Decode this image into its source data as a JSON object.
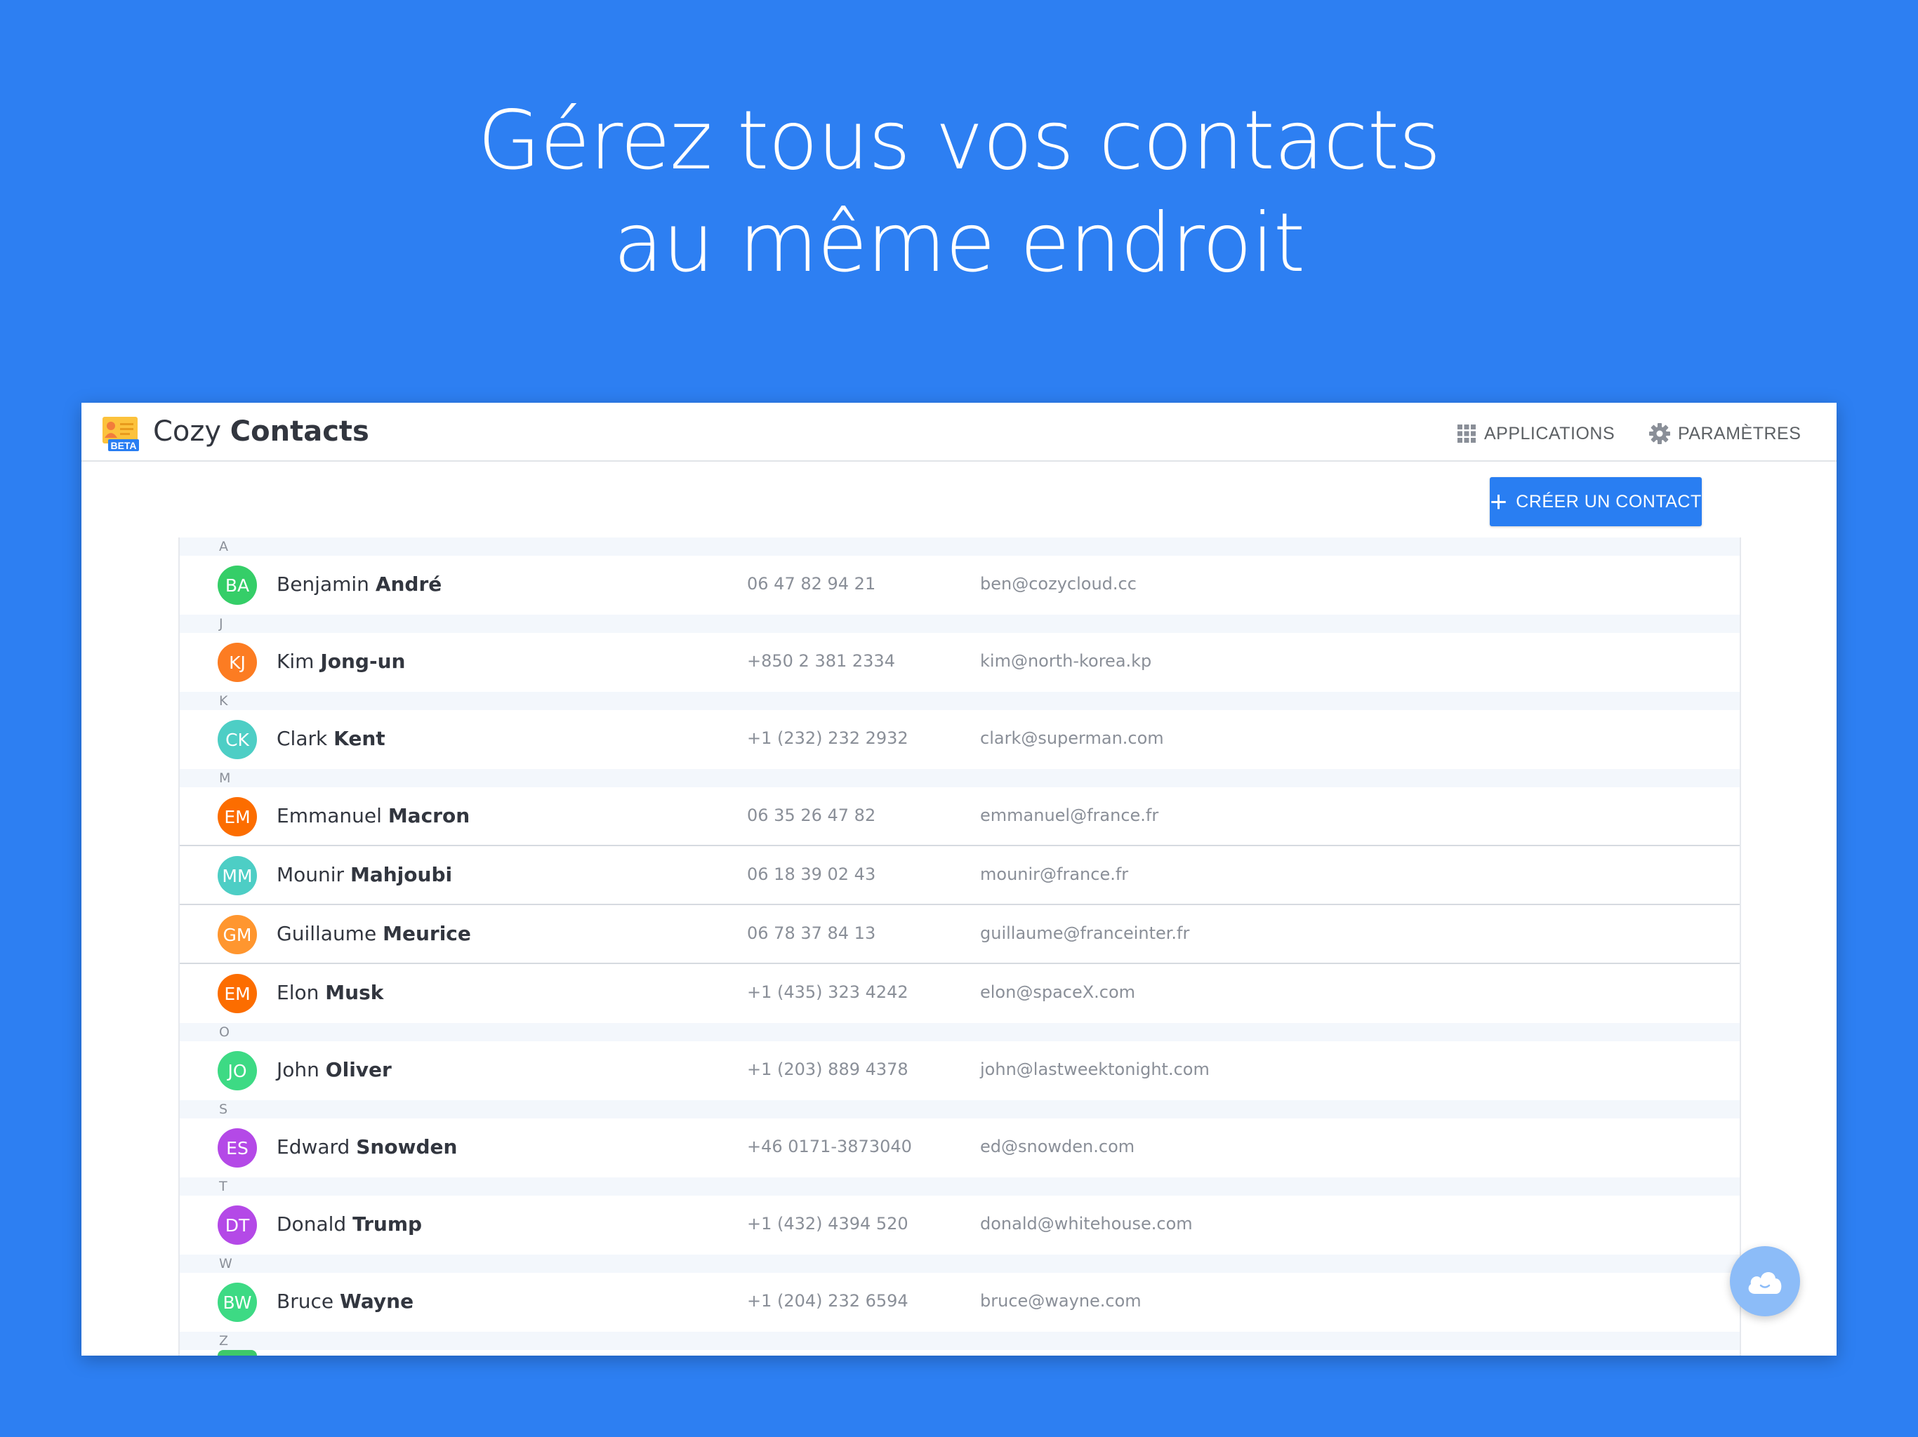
{
  "headline": {
    "line1": "Gérez tous vos contacts",
    "line2": "au même endroit"
  },
  "colors": {
    "background": "#2d7ff2",
    "accent": "#297ef2"
  },
  "app": {
    "logo_badge": "BETA",
    "title_light": "Cozy",
    "title_bold": "Contacts"
  },
  "nav": {
    "applications_label": "APPLICATIONS",
    "applications_icon": "grid-icon",
    "settings_label": "PARAMÈTRES",
    "settings_icon": "gear-icon"
  },
  "toolbar": {
    "create_label": "CRÉER UN CONTACT",
    "create_icon": "+"
  },
  "sections": [
    {
      "letter": "A",
      "contacts": [
        {
          "initials": "BA",
          "first": "Benjamin",
          "last": "André",
          "phone": "06 47 82 94 21",
          "email": "ben@cozycloud.cc",
          "color": "#35ce68"
        }
      ]
    },
    {
      "letter": "J",
      "contacts": [
        {
          "initials": "KJ",
          "first": "Kim",
          "last": "Jong-un",
          "phone": "+850 2 381 2334",
          "email": "kim@north-korea.kp",
          "color": "#fc7c22"
        }
      ]
    },
    {
      "letter": "K",
      "contacts": [
        {
          "initials": "CK",
          "first": "Clark",
          "last": "Kent",
          "phone": "+1 (232) 232 2932",
          "email": "clark@superman.com",
          "color": "#4dcec5"
        }
      ]
    },
    {
      "letter": "M",
      "contacts": [
        {
          "initials": "EM",
          "first": "Emmanuel",
          "last": "Macron",
          "phone": "06 35 26 47 82",
          "email": "emmanuel@france.fr",
          "color": "#fc6d00"
        },
        {
          "initials": "MM",
          "first": "Mounir",
          "last": "Mahjoubi",
          "phone": "06 18 39 02 43",
          "email": "mounir@france.fr",
          "color": "#4dcec5"
        },
        {
          "initials": "GM",
          "first": "Guillaume",
          "last": "Meurice",
          "phone": "06 78 37 84 13",
          "email": "guillaume@franceinter.fr",
          "color": "#ff962f"
        },
        {
          "initials": "EM",
          "first": "Elon",
          "last": "Musk",
          "phone": "+1 (435) 323 4242",
          "email": "elon@spaceX.com",
          "color": "#fc6d00"
        }
      ]
    },
    {
      "letter": "O",
      "contacts": [
        {
          "initials": "JO",
          "first": "John",
          "last": "Oliver",
          "phone": "+1 (203) 889 4378",
          "email": "john@lastweektonight.com",
          "color": "#3dda84"
        }
      ]
    },
    {
      "letter": "S",
      "contacts": [
        {
          "initials": "ES",
          "first": "Edward",
          "last": "Snowden",
          "phone": "+46 0171-3873040",
          "email": "ed@snowden.com",
          "color": "#b449e7"
        }
      ]
    },
    {
      "letter": "T",
      "contacts": [
        {
          "initials": "DT",
          "first": "Donald",
          "last": "Trump",
          "phone": "+1 (432) 4394 520",
          "email": "donald@whitehouse.com",
          "color": "#b449e7"
        }
      ]
    },
    {
      "letter": "W",
      "contacts": [
        {
          "initials": "BW",
          "first": "Bruce",
          "last": "Wayne",
          "phone": "+1 (204) 232 6594",
          "email": "bruce@wayne.com",
          "color": "#3dda84"
        }
      ]
    },
    {
      "letter": "Z",
      "contacts": []
    }
  ],
  "help_button": {
    "icon": "cloud-icon"
  }
}
